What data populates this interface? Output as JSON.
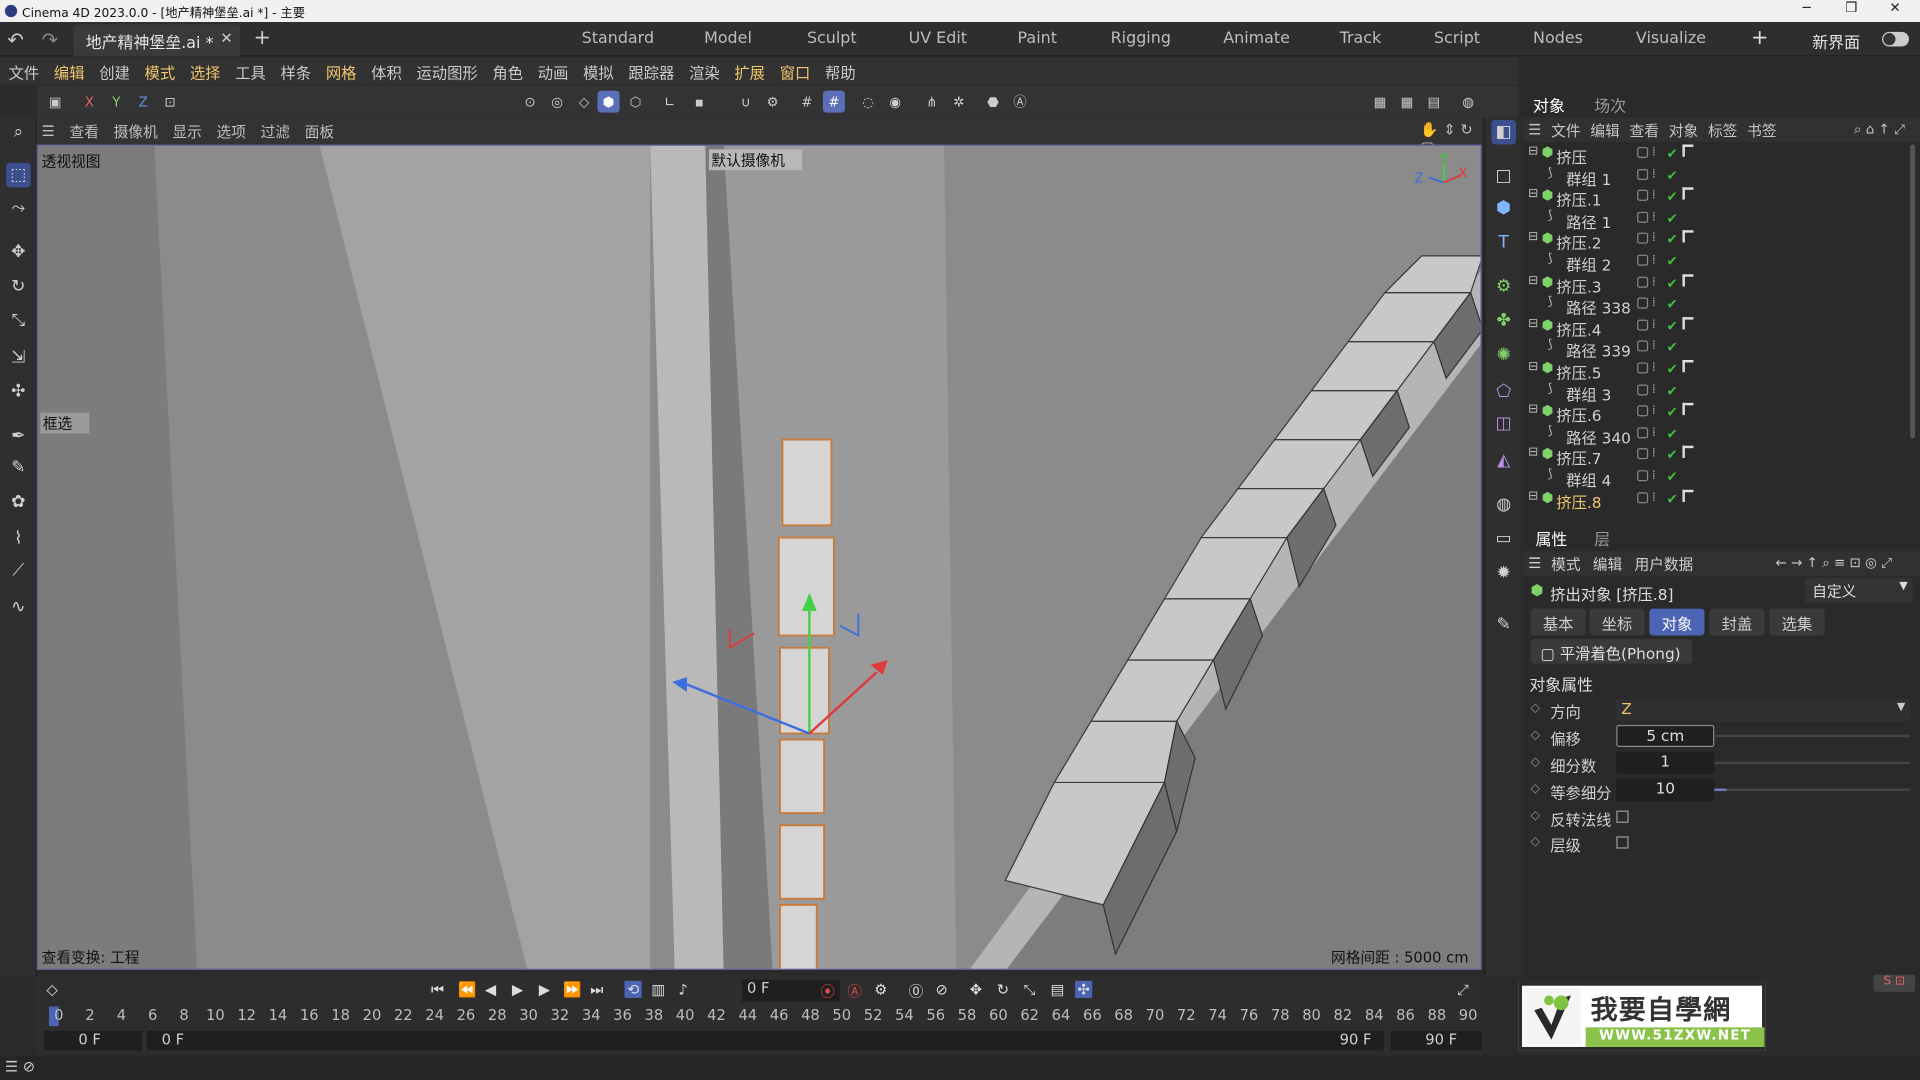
{
  "titlebar": {
    "title": "Cinema 4D 2023.0.0 - [地产精神堡垒.ai *] - 主要"
  },
  "doc_tab": {
    "label": "地产精神堡垒.ai *"
  },
  "layouts": [
    "Standard",
    "Model",
    "Sculpt",
    "UV Edit",
    "Paint",
    "Rigging",
    "Animate",
    "Track",
    "Script",
    "Nodes",
    "Visualize"
  ],
  "layout_new": "新界面",
  "menu": [
    "文件",
    "编辑",
    "创建",
    "模式",
    "选择",
    "工具",
    "样条",
    "网格",
    "体积",
    "运动图形",
    "角色",
    "动画",
    "模拟",
    "跟踪器",
    "渲染",
    "扩展",
    "窗口",
    "帮助"
  ],
  "toolbar": {
    "x": "X",
    "y": "Y",
    "z": "Z"
  },
  "viewport_menu": [
    "查看",
    "摄像机",
    "显示",
    "选项",
    "过滤",
    "面板"
  ],
  "viewport": {
    "name": "透视视图",
    "camera": "默认摄像机",
    "select_label": "框选",
    "status": "查看变换: 工程",
    "grid": "网格间距 : 5000 cm",
    "axis_x": "X",
    "axis_y": "Y",
    "axis_z": "Z"
  },
  "timeline": {
    "ticks": [
      "0",
      "2",
      "4",
      "6",
      "8",
      "10",
      "12",
      "14",
      "16",
      "18",
      "20",
      "22",
      "24",
      "26",
      "28",
      "30",
      "32",
      "34",
      "36",
      "38",
      "40",
      "42",
      "44",
      "46",
      "48",
      "50",
      "52",
      "54",
      "56",
      "58",
      "60",
      "62",
      "64",
      "66",
      "68",
      "70",
      "72",
      "74",
      "76",
      "78",
      "80",
      "82",
      "84",
      "86",
      "88",
      "90"
    ],
    "current_frame": "0 F",
    "start": "0 F",
    "min": "0 F",
    "max": "90 F",
    "end": "90 F"
  },
  "object_manager": {
    "tabs": [
      "对象",
      "场次"
    ],
    "menu": [
      "文件",
      "编辑",
      "查看",
      "对象",
      "标签",
      "书签"
    ],
    "objects": [
      {
        "name": "挤压",
        "child": false
      },
      {
        "name": "群组 1",
        "child": true
      },
      {
        "name": "挤压.1",
        "child": false
      },
      {
        "name": "路径 1",
        "child": true
      },
      {
        "name": "挤压.2",
        "child": false
      },
      {
        "name": "群组 2",
        "child": true
      },
      {
        "name": "挤压.3",
        "child": false
      },
      {
        "name": "路径 338",
        "child": true
      },
      {
        "name": "挤压.4",
        "child": false
      },
      {
        "name": "路径 339",
        "child": true
      },
      {
        "name": "挤压.5",
        "child": false
      },
      {
        "name": "群组 3",
        "child": true
      },
      {
        "name": "挤压.6",
        "child": false
      },
      {
        "name": "路径 340",
        "child": true
      },
      {
        "name": "挤压.7",
        "child": false
      },
      {
        "name": "群组 4",
        "child": true
      },
      {
        "name": "挤压.8",
        "child": false,
        "selected": true
      }
    ]
  },
  "attributes": {
    "tabs": [
      "属性",
      "层"
    ],
    "menu": [
      "模式",
      "编辑",
      "用户数据"
    ],
    "object_title": "挤出对象 [挤压.8]",
    "preset": "自定义",
    "subtabs": [
      "基本",
      "坐标",
      "对象",
      "封盖",
      "选集"
    ],
    "phong": "平滑着色(Phong)",
    "section": "对象属性",
    "props": [
      {
        "label": "方向",
        "value": "Z"
      },
      {
        "label": "偏移",
        "value": "5 cm"
      },
      {
        "label": "细分数",
        "value": "1"
      },
      {
        "label": "等参细分",
        "value": "10"
      },
      {
        "label": "反转法线",
        "value": ""
      },
      {
        "label": "层级",
        "value": ""
      }
    ]
  },
  "logo": {
    "main": "我要自學網",
    "url": "WWW.51ZXW.NET"
  },
  "colors": {
    "accent": "#4b64b3",
    "highlight": "#f0c56e",
    "check": "#3fbf3f",
    "viewport_bg": "#8a8a8a"
  }
}
